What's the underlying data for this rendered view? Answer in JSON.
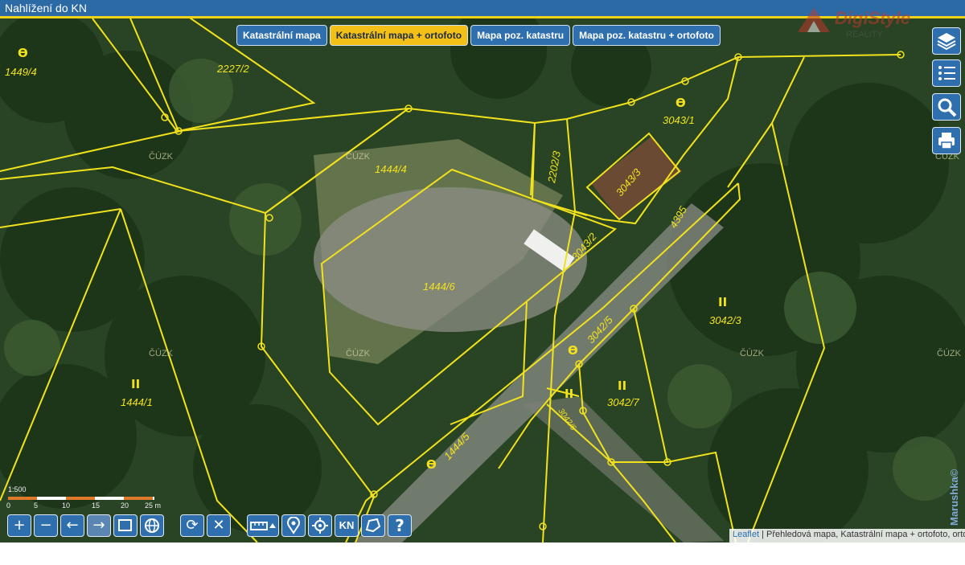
{
  "window": {
    "title": "Nahlížení do KN"
  },
  "tabs": [
    {
      "label": "Katastrální mapa",
      "active": false
    },
    {
      "label": "Katastrální mapa + ortofoto",
      "active": true
    },
    {
      "label": "Mapa poz. katastru",
      "active": false
    },
    {
      "label": "Mapa poz. katastru + ortofoto",
      "active": false
    }
  ],
  "logo": {
    "text": "DigiStyle",
    "sub": "REALITY"
  },
  "right_tools": [
    {
      "name": "layers-icon"
    },
    {
      "name": "legend-list-icon"
    },
    {
      "name": "search-zoom-icon"
    },
    {
      "name": "print-icon"
    }
  ],
  "parcels": {
    "p1449_4": "1449/4",
    "p2227_2": "2227/2",
    "p1444_4": "1444/4",
    "p2202_3": "2202/3",
    "p3043_1": "3043/1",
    "p3043_3": "3043/3",
    "p3043_2": "3043/2",
    "p4395": "4395",
    "p1444_6": "1444/6",
    "p3042_3": "3042/3",
    "p3042_5": "3042/5",
    "p3042_7": "3042/7",
    "p3042_6": "3042/6",
    "p1444_1": "1444/1",
    "p1444_5": "1444/5"
  },
  "watermark": "ČÚZK",
  "scale": {
    "ticks": [
      "0",
      "5",
      "10",
      "15",
      "20",
      "25 m"
    ],
    "label": "1:500"
  },
  "toolbar": {
    "kn_label": "KN",
    "help_label": "?"
  },
  "attribution": {
    "link": "Leaflet",
    "text": " | Přehledová mapa, Katastrální mapa + ortofoto, orto"
  },
  "marushka": "Marushka©",
  "colors": {
    "parcel_line": "#f2e21c",
    "button": "#2f6fae",
    "active_tab": "#f3c018",
    "titlebar": "#2c6aa6"
  }
}
